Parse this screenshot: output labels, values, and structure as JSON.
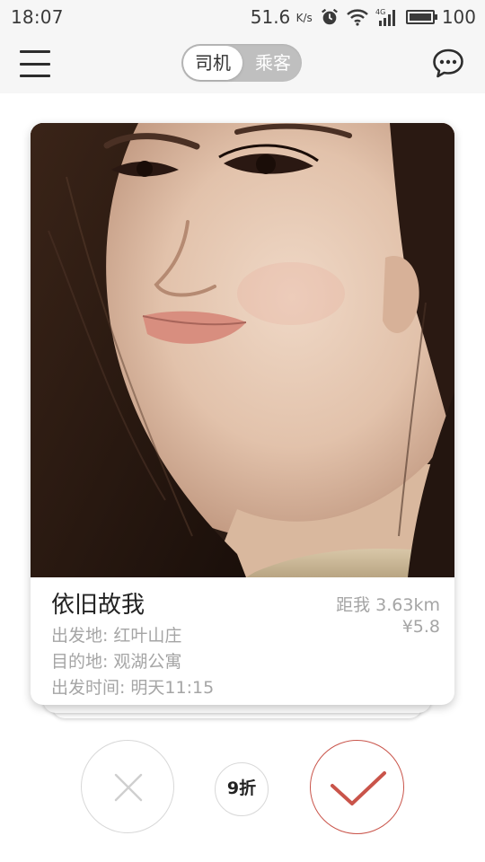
{
  "status_bar": {
    "time": "18:07",
    "network_speed": "51.6",
    "network_unit": "K/s",
    "battery": "100",
    "battery_level": 1.0,
    "icons": [
      "alarm-icon",
      "wifi-icon",
      "signal-4g-icon",
      "battery-icon"
    ]
  },
  "header": {
    "menu_icon": "hamburger-menu-icon",
    "toggle": {
      "driver_label": "司机",
      "passenger_label": "乘客",
      "selected": "driver"
    },
    "chat_icon": "chat-bubble-icon"
  },
  "card": {
    "name": "依旧故我",
    "origin_label": "出发地:",
    "origin_value": "红叶山庄",
    "destination_label": "目的地:",
    "destination_value": "观湖公寓",
    "time_label": "出发时间:",
    "time_value": "明天11:15",
    "distance": "距我 3.63km",
    "price": "¥5.8"
  },
  "actions": {
    "reject_icon": "close-x-icon",
    "discount_label": "9折",
    "accept_icon": "checkmark-icon"
  },
  "colors": {
    "accent": "#c9544a",
    "toggle_bg": "#bfbfbf",
    "muted_text": "#a5a5a5",
    "header_bg": "#f6f6f6"
  }
}
